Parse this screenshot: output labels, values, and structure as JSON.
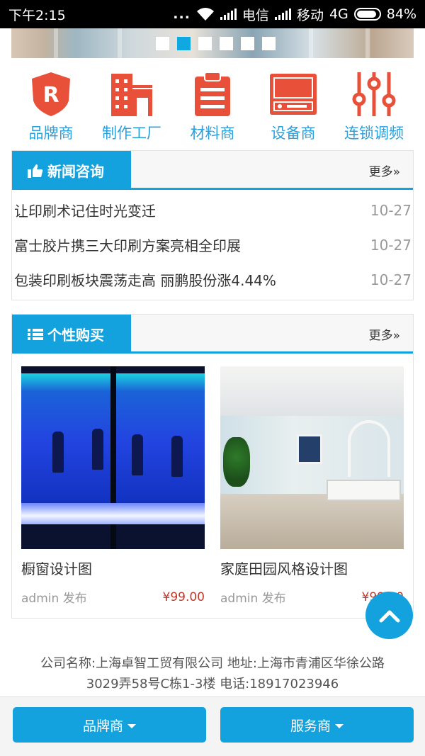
{
  "status_bar": {
    "time": "下午2:15",
    "dots": "...",
    "carrier1": "电信",
    "carrier2": "移动",
    "network": "4G",
    "battery": "84%"
  },
  "banner": {
    "slide_count": 6,
    "active_slide": 2
  },
  "categories": [
    {
      "label": "品牌商",
      "icon": "brand-shield-icon"
    },
    {
      "label": "制作工厂",
      "icon": "factory-building-icon"
    },
    {
      "label": "材料商",
      "icon": "clipboard-icon"
    },
    {
      "label": "设备商",
      "icon": "device-icon"
    },
    {
      "label": "连锁调频",
      "icon": "equalizer-sliders-icon"
    }
  ],
  "news": {
    "title": "新闻咨询",
    "more": "更多»",
    "items": [
      {
        "title": "让印刷术记住时光变迁",
        "date": "10-27"
      },
      {
        "title": "富士胶片携三大印刷方案亮相全印展",
        "date": "10-27"
      },
      {
        "title": "包装印刷板块震荡走高 丽鹏股份涨4.44%",
        "date": "10-27"
      }
    ]
  },
  "shop": {
    "title": "个性购买",
    "more": "更多»",
    "products": [
      {
        "name": "橱窗设计图",
        "author": "admin 发布",
        "price": "¥99.00"
      },
      {
        "name": "家庭田园风格设计图",
        "author": "admin 发布",
        "price": "¥99.00"
      }
    ]
  },
  "footer": {
    "line1": "公司名称:上海卓智工贸有限公司 地址:上海市青浦区华徐公路",
    "line2": "3029弄58号C栋1-3楼 电话:18917023946"
  },
  "bottom_bar": {
    "left": "品牌商",
    "right": "服务商"
  },
  "colors": {
    "accent": "#13a2dd",
    "icon_red": "#e8503a",
    "price": "#c0392b"
  }
}
